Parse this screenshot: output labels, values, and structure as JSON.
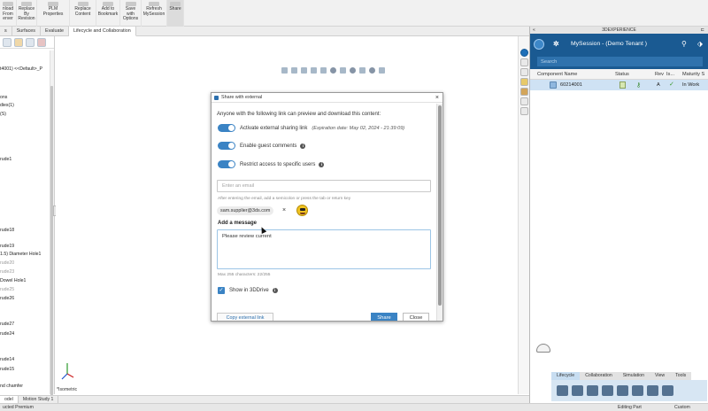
{
  "ribbon": {
    "buttons": [
      {
        "label": "nload\nFrom\nerver"
      },
      {
        "label": "Replace\nBy\nRevision"
      },
      {
        "label": "PLM\nProperties"
      },
      {
        "label": "Replace\nContent"
      },
      {
        "label": "Add to\nBookmark"
      },
      {
        "label": "Save\nwith\nOptions"
      },
      {
        "label": "Refresh\nMySession"
      },
      {
        "label": "Share"
      }
    ]
  },
  "tabs": [
    {
      "label": "s"
    },
    {
      "label": "Surfaces"
    },
    {
      "label": "Evaluate"
    },
    {
      "label": "Lifecycle and Collaboration"
    }
  ],
  "tree": {
    "items": [
      {
        "label": "t4001) <<Default>_P",
        "dim": false
      },
      {
        "label": "ons",
        "dim": false
      },
      {
        "label": "dies(1)",
        "dim": false
      },
      {
        "label": "(S)",
        "dim": false
      },
      {
        "label": "rude1",
        "dim": false
      },
      {
        "label": "rude18",
        "dim": false
      },
      {
        "label": "rude19",
        "dim": false
      },
      {
        "label": "1.5) Diameter Hole1",
        "dim": false
      },
      {
        "label": "rude20",
        "dim": true
      },
      {
        "label": "rude23",
        "dim": true
      },
      {
        "label": "Dowel Hole1",
        "dim": false
      },
      {
        "label": "rude25",
        "dim": true
      },
      {
        "label": "rude26",
        "dim": false
      },
      {
        "label": "rude27",
        "dim": false
      },
      {
        "label": "rude24",
        "dim": false
      },
      {
        "label": "rude14",
        "dim": false
      },
      {
        "label": "rude15",
        "dim": false
      },
      {
        "label": "nd chamfer",
        "dim": false
      }
    ]
  },
  "viewport": {
    "view_label": "*Isometric"
  },
  "bottom_tabs": [
    {
      "label": "odel"
    },
    {
      "label": "Motion Study 1"
    }
  ],
  "status": {
    "left": "ucted Premium",
    "mode": "Editing Part",
    "units": "Custom"
  },
  "xpanel": {
    "title": "3DEXPERIENCE",
    "session": "MySession - (Demo Tenant )",
    "search_placeholder": "Search",
    "columns": [
      "Component Name",
      "Status",
      "Rev",
      "Is...",
      "Maturity S"
    ],
    "row": {
      "name": "60214001",
      "rev": "A",
      "maturity": "In Work"
    },
    "lifecycle_tabs": [
      "Lifecycle",
      "Collaboration",
      "Simulation",
      "View",
      "Tools"
    ]
  },
  "dialog": {
    "title": "Share with external",
    "intro": "Anyone with the following link can preview and download this content:",
    "toggles": [
      {
        "label": "Activate external sharing link",
        "extra": "(Expiration date: May 02, 2024 - 21:39:09)",
        "info": false
      },
      {
        "label": "Enable guest comments",
        "extra": "",
        "info": true
      },
      {
        "label": "Restrict access to specific users",
        "extra": "",
        "info": true
      }
    ],
    "email_placeholder": "Enter an email",
    "hint": "After entering the email, add a semicolon or press the tab or return key",
    "chip": "sam.supplier@3ds.com",
    "message_label": "Add a message",
    "message": "Please review current",
    "max_chars": "Max 255 characters: 22/255",
    "show_label": "Show in 3DDrive",
    "copy_link": "Copy external link",
    "share": "Share",
    "close": "Close"
  },
  "colors": {
    "accent": "#3a83c4",
    "header": "#1a5a92",
    "selected_row": "#cfe2f4"
  }
}
